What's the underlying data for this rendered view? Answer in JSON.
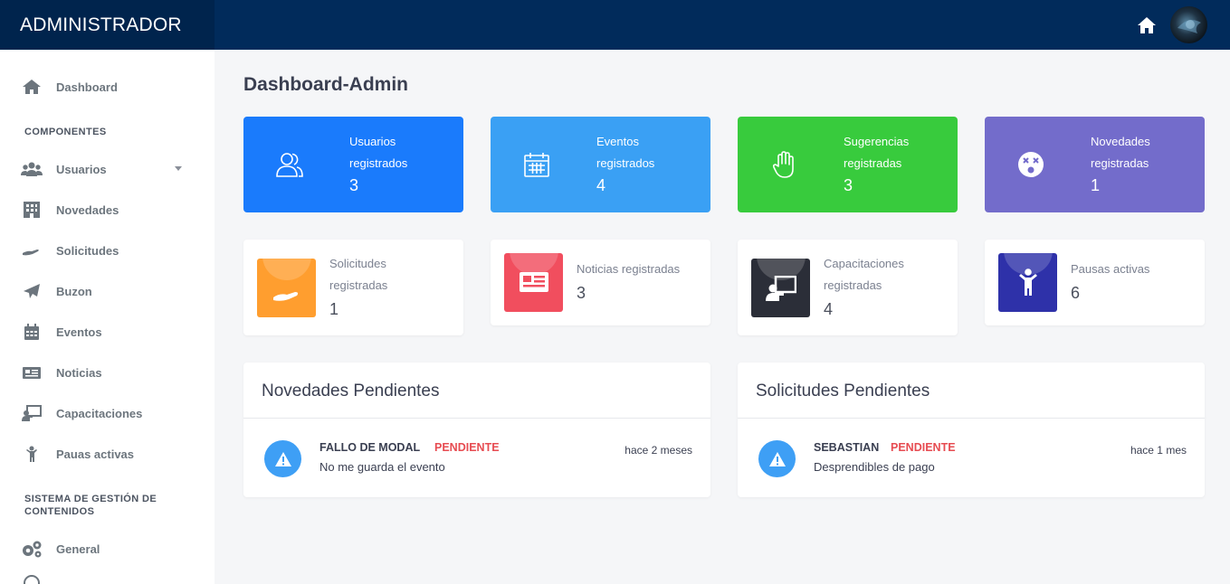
{
  "header": {
    "brand": "ADMINISTRADOR",
    "home_icon": "home-icon",
    "avatar_icon": "user-avatar"
  },
  "sidebar": {
    "items": [
      {
        "label": "Dashboard",
        "icon": "home-icon"
      },
      {
        "label": "Usuarios",
        "icon": "users-icon"
      },
      {
        "label": "Novedades",
        "icon": "building-icon"
      },
      {
        "label": "Solicitudes",
        "icon": "hand-holding-icon"
      },
      {
        "label": "Buzon",
        "icon": "paper-plane-icon"
      },
      {
        "label": "Eventos",
        "icon": "calendar-icon"
      },
      {
        "label": "Noticias",
        "icon": "newspaper-icon"
      },
      {
        "label": "Capacitaciones",
        "icon": "chalkboard-teacher-icon"
      },
      {
        "label": "Pauas activas",
        "icon": "child-icon"
      },
      {
        "label": "General",
        "icon": "cogs-icon"
      }
    ],
    "sections": {
      "componentes": "COMPONENTES",
      "sistema_line1": "SISTEMA DE GESTIÓN DE",
      "sistema_line2": "CONTENIDOS"
    }
  },
  "main": {
    "title": "Dashboard-Admin",
    "stats_primary": [
      {
        "line1": "Usuarios",
        "line2": "registrados",
        "value": "3",
        "color": "#1a7bfc",
        "icon": "user-friends-icon"
      },
      {
        "line1": "Eventos",
        "line2": "registrados",
        "value": "4",
        "color": "#3aa0f4",
        "icon": "calendar-icon"
      },
      {
        "line1": "Sugerencias",
        "line2": "registradas",
        "value": "3",
        "color": "#38cb3d",
        "icon": "hand-paper-icon"
      },
      {
        "line1": "Novedades",
        "line2": "registradas",
        "value": "1",
        "color": "#736ccb",
        "icon": "dizzy-face-icon"
      }
    ],
    "stats_secondary": [
      {
        "line1": "Solicitudes",
        "line2": "registradas",
        "value": "1",
        "color": "#ff9e2f",
        "icon": "hand-holding-icon"
      },
      {
        "line1": "Noticias registradas",
        "line2": "",
        "value": "3",
        "color": "#f14e5e",
        "icon": "newspaper-icon"
      },
      {
        "line1": "Capacitaciones",
        "line2": "registradas",
        "value": "4",
        "color": "#2b2e38",
        "icon": "chalkboard-teacher-icon"
      },
      {
        "line1": "Pausas activas",
        "line2": "",
        "value": "6",
        "color": "#2e31a9",
        "icon": "child-icon"
      }
    ],
    "panels": [
      {
        "title": "Novedades Pendientes",
        "item": {
          "name": "FALLO DE MODAL",
          "status": "PENDIENTE",
          "description": "No me guarda el evento",
          "time": "hace 2 meses",
          "icon": "warning-icon"
        }
      },
      {
        "title": "Solicitudes Pendientes",
        "item": {
          "name": "SEBASTIAN",
          "status": "PENDIENTE",
          "description": "Desprendibles de pago",
          "time": "hace 1 mes",
          "icon": "warning-icon"
        }
      }
    ]
  }
}
